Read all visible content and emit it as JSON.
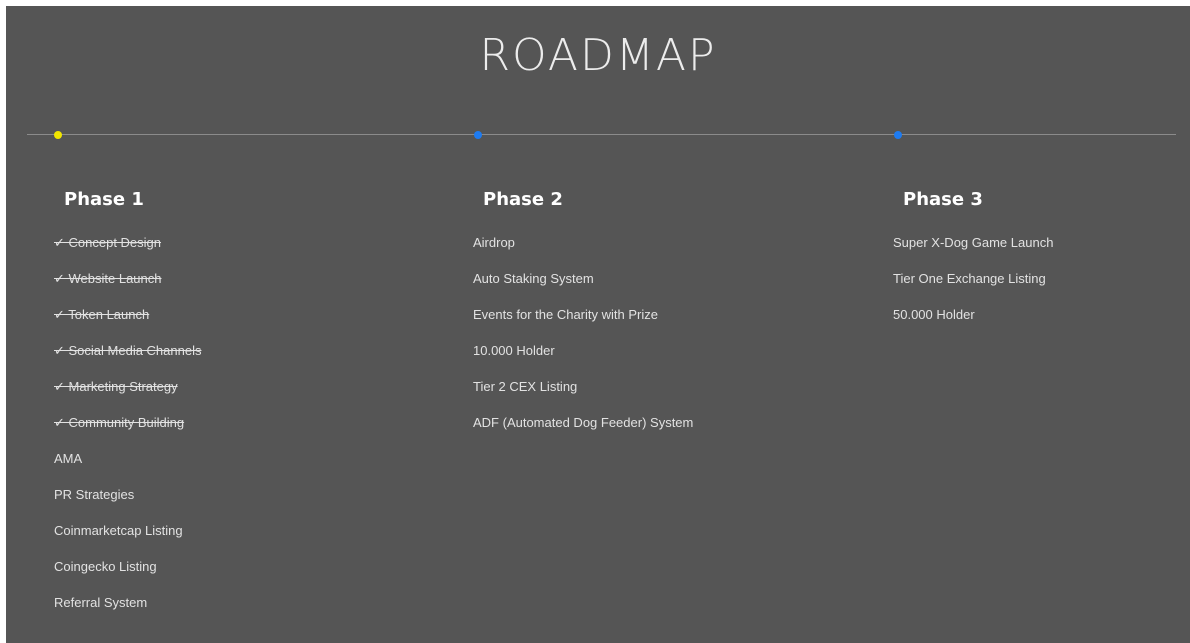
{
  "title": "ROADMAP",
  "colors": {
    "background": "#555555",
    "timeline": "#8b8b8b",
    "active_dot": "#f2e600",
    "upcoming_dot": "#1e7bf0"
  },
  "timeline_markers": [
    {
      "state": "active"
    },
    {
      "state": "upcoming"
    },
    {
      "state": "upcoming"
    }
  ],
  "phases": [
    {
      "title": "Phase 1",
      "items": [
        {
          "label": "✓ Concept Design",
          "done": true
        },
        {
          "label": "✓ Website Launch",
          "done": true
        },
        {
          "label": "✓ Token Launch",
          "done": true
        },
        {
          "label": "✓ Social Media Channels",
          "done": true
        },
        {
          "label": "✓ Marketing Strategy",
          "done": true
        },
        {
          "label": "✓ Community Building",
          "done": true
        },
        {
          "label": "AMA",
          "done": false
        },
        {
          "label": "PR Strategies",
          "done": false
        },
        {
          "label": "Coinmarketcap Listing",
          "done": false
        },
        {
          "label": "Coingecko Listing",
          "done": false
        },
        {
          "label": "Referral System",
          "done": false
        }
      ]
    },
    {
      "title": "Phase 2",
      "items": [
        {
          "label": "Airdrop",
          "done": false
        },
        {
          "label": "Auto Staking System",
          "done": false
        },
        {
          "label": "Events for the Charity with Prize",
          "done": false
        },
        {
          "label": "10.000 Holder",
          "done": false
        },
        {
          "label": "Tier 2 CEX Listing",
          "done": false
        },
        {
          "label": "ADF (Automated Dog Feeder) System",
          "done": false
        }
      ]
    },
    {
      "title": "Phase 3",
      "items": [
        {
          "label": "Super X-Dog Game Launch",
          "done": false
        },
        {
          "label": "Tier One Exchange Listing",
          "done": false
        },
        {
          "label": "50.000 Holder",
          "done": false
        }
      ]
    }
  ]
}
